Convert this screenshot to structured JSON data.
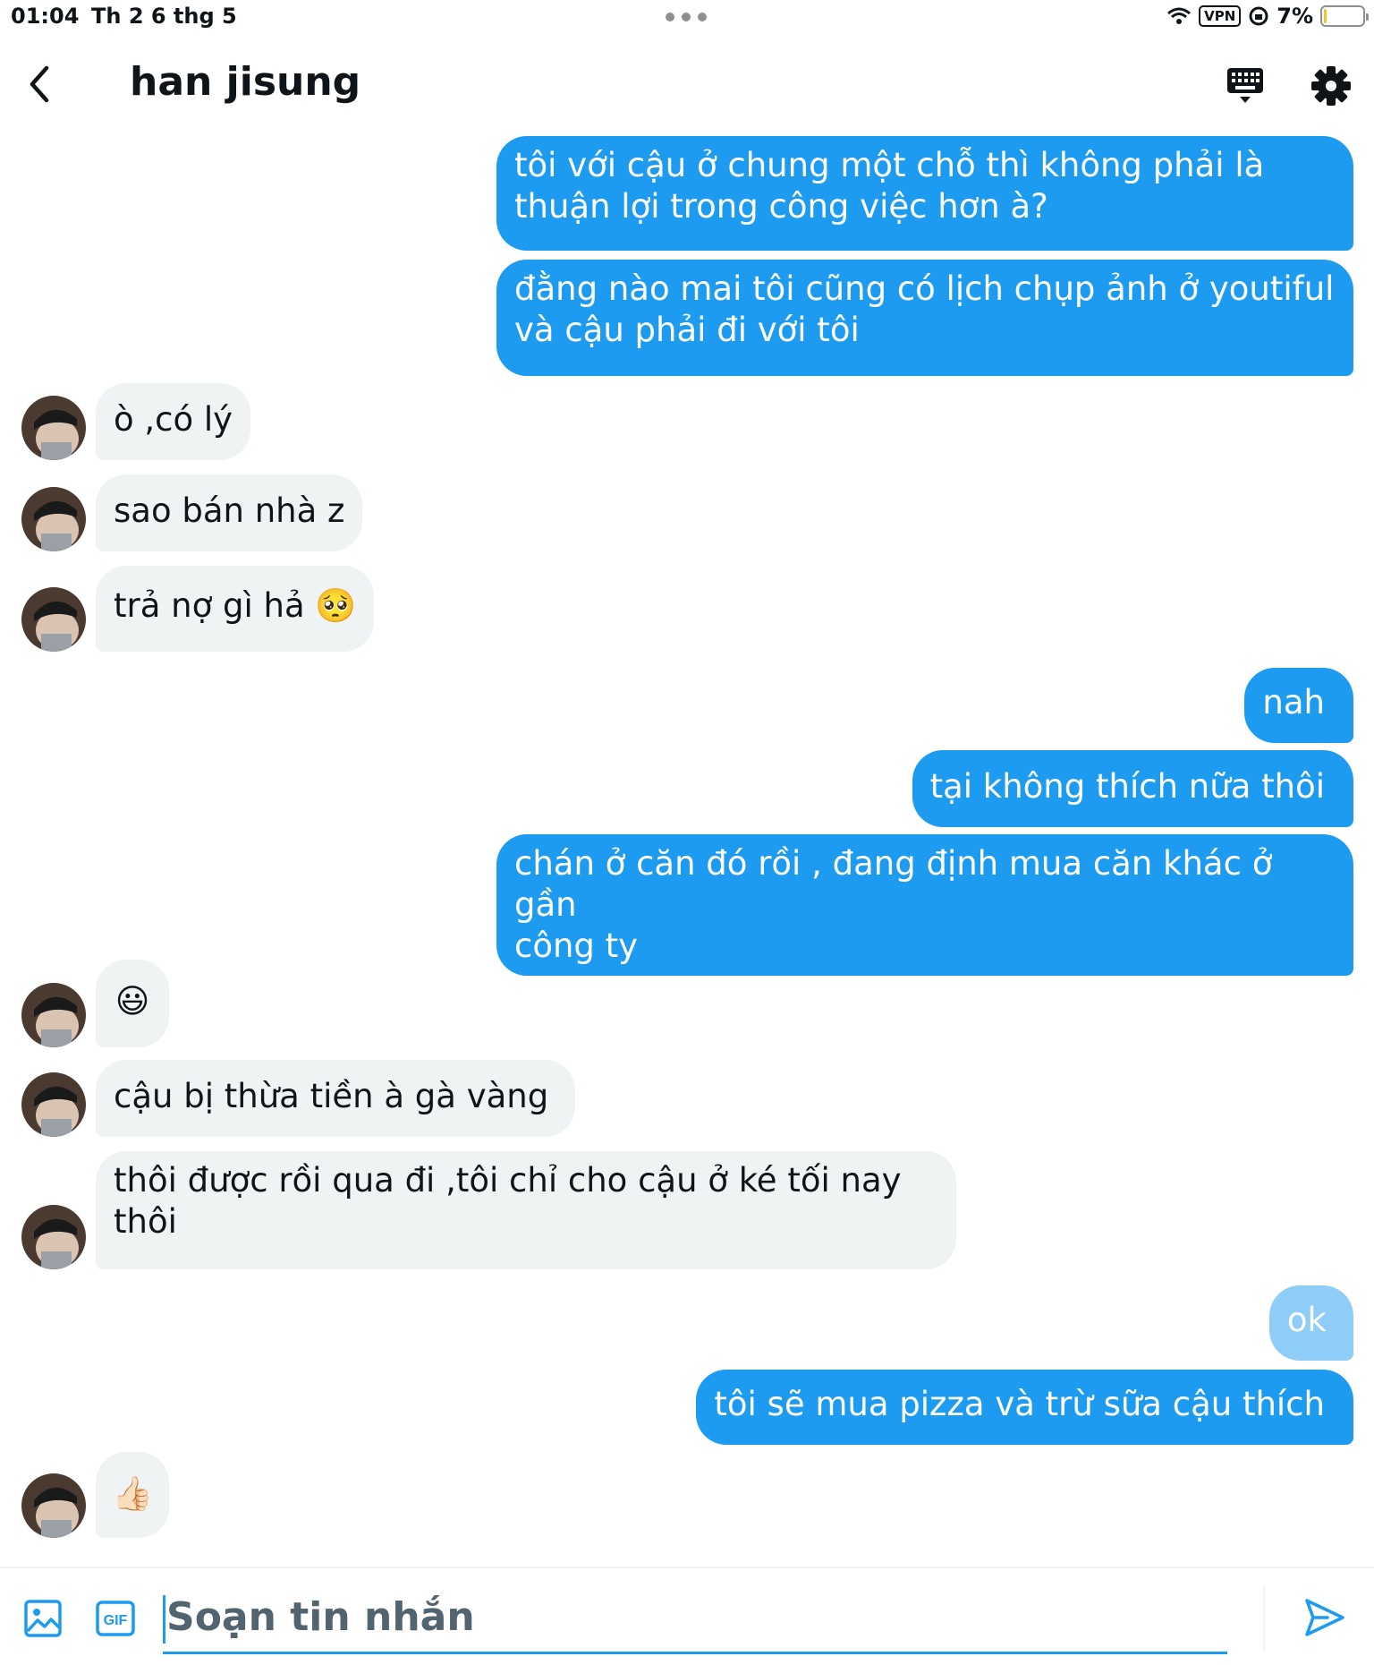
{
  "status_bar": {
    "time": "01:04",
    "date": "Th 2 6 thg 5",
    "vpn": "VPN",
    "battery": "7%",
    "battery_level": 0.07
  },
  "header": {
    "title": "han jisung"
  },
  "messages": [
    {
      "direction": "sent",
      "text": "tôi với cậu ở chung một chỗ thì không phải là\nthuận lợi trong công việc hơn à?"
    },
    {
      "direction": "sent",
      "text": "đằng nào mai tôi cũng có lịch chụp ảnh ở youtiful\nvà cậu phải đi với tôi"
    },
    {
      "direction": "received",
      "text": "ò ,có lý"
    },
    {
      "direction": "received",
      "text": "sao bán nhà z"
    },
    {
      "direction": "received",
      "text": "trả nợ gì hả 🥺"
    },
    {
      "direction": "sent",
      "text": "nah"
    },
    {
      "direction": "sent",
      "text": "tại không thích nữa thôi"
    },
    {
      "direction": "sent",
      "text": "chán ở căn đó rồi , đang định mua căn khác ở gần\ncông ty"
    },
    {
      "direction": "received",
      "text": "😃"
    },
    {
      "direction": "received",
      "text": "cậu bị thừa tiền à gà vàng"
    },
    {
      "direction": "received",
      "text": "thôi được rồi qua đi ,tôi chỉ cho cậu ở ké tối nay\nthôi"
    },
    {
      "direction": "sent",
      "text": "ok"
    },
    {
      "direction": "sent",
      "text": "tôi sẽ mua pizza và trừ sữa cậu thích"
    },
    {
      "direction": "received",
      "text": "👍🏻"
    }
  ],
  "composer": {
    "placeholder": "Soạn tin nhắn",
    "gif_label": "GIF"
  },
  "colors": {
    "accent": "#1d9bf0",
    "sent_bubble": "#1d9bf0",
    "received_bubble": "#eff3f4"
  }
}
